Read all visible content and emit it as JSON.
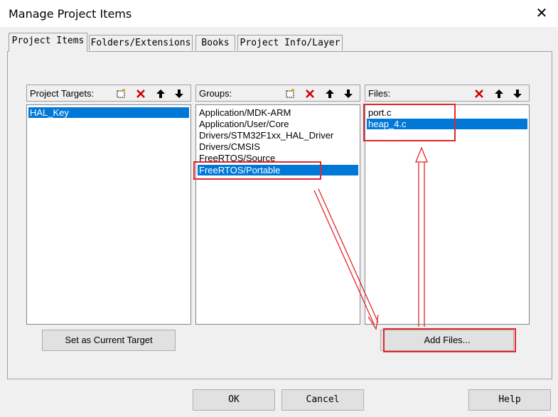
{
  "window": {
    "title": "Manage Project Items",
    "close_glyph": "✕"
  },
  "tabs": [
    {
      "label": "Project Items",
      "active": true
    },
    {
      "label": "Folders/Extensions",
      "active": false
    },
    {
      "label": "Books",
      "active": false
    },
    {
      "label": "Project Info/Layer",
      "active": false
    }
  ],
  "targets": {
    "header": "Project Targets:",
    "items": [
      {
        "label": "HAL_Key",
        "selected": true
      }
    ],
    "set_current_button": "Set as Current Target"
  },
  "groups": {
    "header": "Groups:",
    "items": [
      {
        "label": "Application/MDK-ARM",
        "selected": false
      },
      {
        "label": "Application/User/Core",
        "selected": false
      },
      {
        "label": "Drivers/STM32F1xx_HAL_Driver",
        "selected": false
      },
      {
        "label": "Drivers/CMSIS",
        "selected": false
      },
      {
        "label": "FreeRTOS/Source",
        "selected": false
      },
      {
        "label": "FreeRTOS/Portable",
        "selected": true
      }
    ]
  },
  "files": {
    "header": "Files:",
    "items": [
      {
        "label": "port.c",
        "selected": false
      },
      {
        "label": "heap_4.c",
        "selected": true
      }
    ],
    "add_files_button": "Add Files..."
  },
  "toolbar_icons": {
    "new": "new-item-icon",
    "delete": "delete-x-icon",
    "up": "move-up-arrow-icon",
    "down": "move-down-arrow-icon"
  },
  "footer": {
    "ok": "OK",
    "cancel": "Cancel",
    "help": "Help"
  },
  "colors": {
    "selection": "#0078d7",
    "annotation_red": "#e3262b",
    "delete_icon_red": "#cc0000"
  }
}
